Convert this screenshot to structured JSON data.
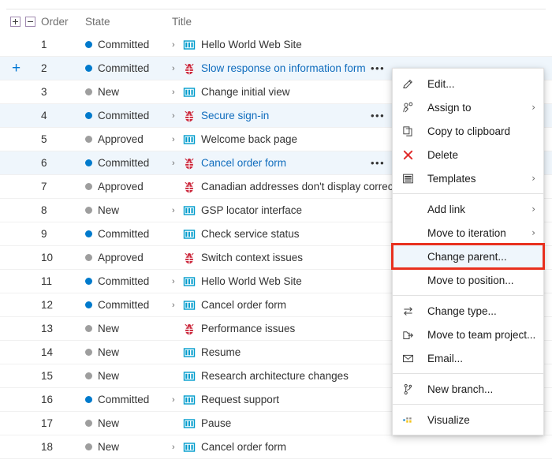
{
  "colors": {
    "accent": "#0078d4",
    "link": "#0f6cbd",
    "bug": "#cc293d",
    "pbi": "#009ccc",
    "highlight_row": "#eff6fc",
    "callout_border": "#e8301e",
    "state_committed": "#007acc",
    "state_inactive": "#9e9e9e"
  },
  "grid": {
    "header": {
      "expand_all_label": "+",
      "collapse_all_label": "−",
      "expand_all_name": "expand-all",
      "collapse_all_name": "collapse-all",
      "columns": [
        "Order",
        "State",
        "Title"
      ]
    },
    "rows": [
      {
        "order": "1",
        "state": "Committed",
        "state_kind": "active",
        "title": "Hello World Web Site",
        "type": "pbi",
        "has_chevron": true,
        "has_ellipsis": false,
        "highlighted": false,
        "link": false,
        "row_plus": false
      },
      {
        "order": "2",
        "state": "Committed",
        "state_kind": "active",
        "title": "Slow response on information form",
        "type": "bug",
        "has_chevron": true,
        "has_ellipsis": true,
        "highlighted": true,
        "link": true,
        "row_plus": true
      },
      {
        "order": "3",
        "state": "New",
        "state_kind": "inactive",
        "title": "Change initial view",
        "type": "pbi",
        "has_chevron": true,
        "has_ellipsis": false,
        "highlighted": false,
        "link": false,
        "row_plus": false
      },
      {
        "order": "4",
        "state": "Committed",
        "state_kind": "active",
        "title": "Secure sign-in",
        "type": "bug",
        "has_chevron": true,
        "has_ellipsis": true,
        "highlighted": true,
        "link": true,
        "row_plus": false
      },
      {
        "order": "5",
        "state": "Approved",
        "state_kind": "inactive",
        "title": "Welcome back page",
        "type": "pbi",
        "has_chevron": true,
        "has_ellipsis": false,
        "highlighted": false,
        "link": false,
        "row_plus": false
      },
      {
        "order": "6",
        "state": "Committed",
        "state_kind": "active",
        "title": "Cancel order form",
        "type": "bug",
        "has_chevron": true,
        "has_ellipsis": true,
        "highlighted": true,
        "link": true,
        "row_plus": false
      },
      {
        "order": "7",
        "state": "Approved",
        "state_kind": "inactive",
        "title": "Canadian addresses don't display correctly",
        "type": "bug",
        "has_chevron": false,
        "has_ellipsis": false,
        "highlighted": false,
        "link": false,
        "row_plus": false
      },
      {
        "order": "8",
        "state": "New",
        "state_kind": "inactive",
        "title": "GSP locator interface",
        "type": "pbi",
        "has_chevron": true,
        "has_ellipsis": false,
        "highlighted": false,
        "link": false,
        "row_plus": false
      },
      {
        "order": "9",
        "state": "Committed",
        "state_kind": "active",
        "title": "Check service status",
        "type": "pbi",
        "has_chevron": false,
        "has_ellipsis": false,
        "highlighted": false,
        "link": false,
        "row_plus": false
      },
      {
        "order": "10",
        "state": "Approved",
        "state_kind": "inactive",
        "title": "Switch context issues",
        "type": "bug",
        "has_chevron": false,
        "has_ellipsis": false,
        "highlighted": false,
        "link": false,
        "row_plus": false
      },
      {
        "order": "11",
        "state": "Committed",
        "state_kind": "active",
        "title": "Hello World Web Site",
        "type": "pbi",
        "has_chevron": true,
        "has_ellipsis": false,
        "highlighted": false,
        "link": false,
        "row_plus": false
      },
      {
        "order": "12",
        "state": "Committed",
        "state_kind": "active",
        "title": "Cancel order form",
        "type": "pbi",
        "has_chevron": true,
        "has_ellipsis": false,
        "highlighted": false,
        "link": false,
        "row_plus": false
      },
      {
        "order": "13",
        "state": "New",
        "state_kind": "inactive",
        "title": "Performance issues",
        "type": "bug",
        "has_chevron": false,
        "has_ellipsis": false,
        "highlighted": false,
        "link": false,
        "row_plus": false
      },
      {
        "order": "14",
        "state": "New",
        "state_kind": "inactive",
        "title": "Resume",
        "type": "pbi",
        "has_chevron": false,
        "has_ellipsis": false,
        "highlighted": false,
        "link": false,
        "row_plus": false
      },
      {
        "order": "15",
        "state": "New",
        "state_kind": "inactive",
        "title": "Research architecture changes",
        "type": "pbi",
        "has_chevron": false,
        "has_ellipsis": false,
        "highlighted": false,
        "link": false,
        "row_plus": false
      },
      {
        "order": "16",
        "state": "Committed",
        "state_kind": "active",
        "title": "Request support",
        "type": "pbi",
        "has_chevron": true,
        "has_ellipsis": false,
        "highlighted": false,
        "link": false,
        "row_plus": false
      },
      {
        "order": "17",
        "state": "New",
        "state_kind": "inactive",
        "title": "Pause",
        "type": "pbi",
        "has_chevron": false,
        "has_ellipsis": false,
        "highlighted": false,
        "link": false,
        "row_plus": false
      },
      {
        "order": "18",
        "state": "New",
        "state_kind": "inactive",
        "title": "Cancel order form",
        "type": "pbi",
        "has_chevron": true,
        "has_ellipsis": false,
        "highlighted": false,
        "link": false,
        "row_plus": false
      }
    ]
  },
  "context_menu": {
    "items": [
      {
        "label": "Edit...",
        "icon": "pencil-icon",
        "submenu": false,
        "highlighted": false,
        "separator_after": false
      },
      {
        "label": "Assign to",
        "icon": "person-assign-icon",
        "submenu": true,
        "highlighted": false,
        "separator_after": false
      },
      {
        "label": "Copy to clipboard",
        "icon": "copy-icon",
        "submenu": false,
        "highlighted": false,
        "separator_after": false
      },
      {
        "label": "Delete",
        "icon": "delete-x-icon",
        "submenu": false,
        "highlighted": false,
        "separator_after": false
      },
      {
        "label": "Templates",
        "icon": "templates-icon",
        "submenu": true,
        "highlighted": false,
        "separator_after": true
      },
      {
        "label": "Add link",
        "icon": "none",
        "submenu": true,
        "highlighted": false,
        "separator_after": false
      },
      {
        "label": "Move to iteration",
        "icon": "none",
        "submenu": true,
        "highlighted": false,
        "separator_after": false
      },
      {
        "label": "Change parent...",
        "icon": "none",
        "submenu": false,
        "highlighted": true,
        "separator_after": false
      },
      {
        "label": "Move to position...",
        "icon": "none",
        "submenu": false,
        "highlighted": false,
        "separator_after": true
      },
      {
        "label": "Change type...",
        "icon": "change-type-icon",
        "submenu": false,
        "highlighted": false,
        "separator_after": false
      },
      {
        "label": "Move to team project...",
        "icon": "move-project-icon",
        "submenu": false,
        "highlighted": false,
        "separator_after": false
      },
      {
        "label": "Email...",
        "icon": "envelope-icon",
        "submenu": false,
        "highlighted": false,
        "separator_after": true
      },
      {
        "label": "New branch...",
        "icon": "branch-icon",
        "submenu": false,
        "highlighted": false,
        "separator_after": true
      },
      {
        "label": "Visualize",
        "icon": "visualize-icon",
        "submenu": false,
        "highlighted": false,
        "separator_after": false
      }
    ],
    "submenu_glyph": "›",
    "ellipsis_glyph": "•••"
  }
}
